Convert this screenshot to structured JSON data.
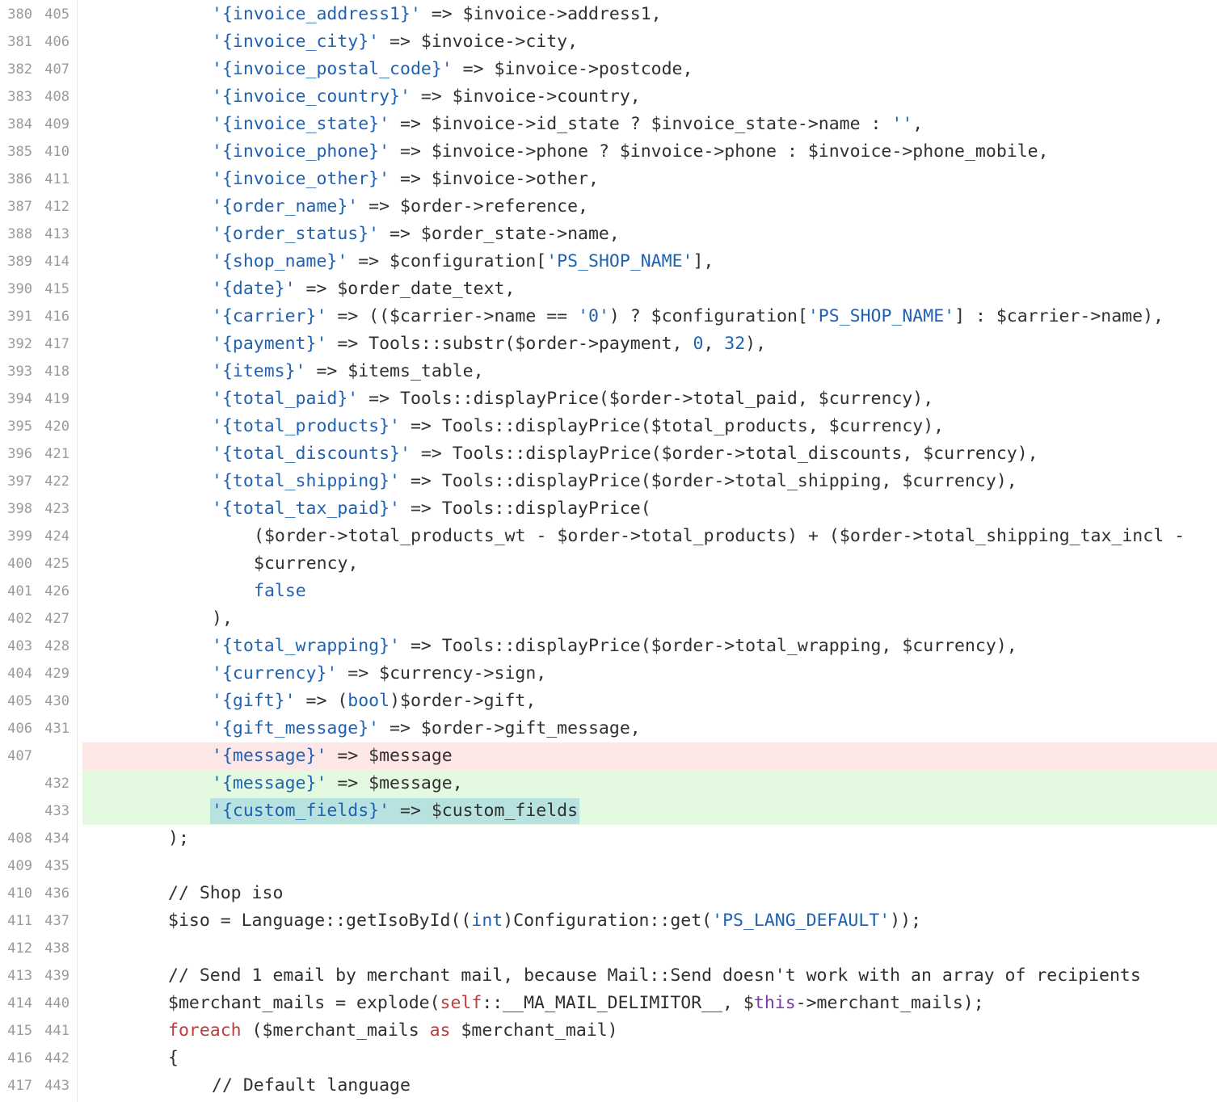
{
  "diff": {
    "lines": [
      {
        "old": "380",
        "new": "405",
        "type": "context",
        "indent": 3,
        "tokens": [
          {
            "t": "'{invoice_address1}'",
            "c": "str"
          },
          {
            "t": " => $invoice->address1,",
            "c": ""
          }
        ]
      },
      {
        "old": "381",
        "new": "406",
        "type": "context",
        "indent": 3,
        "tokens": [
          {
            "t": "'{invoice_city}'",
            "c": "str"
          },
          {
            "t": " => $invoice->city,",
            "c": ""
          }
        ]
      },
      {
        "old": "382",
        "new": "407",
        "type": "context",
        "indent": 3,
        "tokens": [
          {
            "t": "'{invoice_postal_code}'",
            "c": "str"
          },
          {
            "t": " => $invoice->postcode,",
            "c": ""
          }
        ]
      },
      {
        "old": "383",
        "new": "408",
        "type": "context",
        "indent": 3,
        "tokens": [
          {
            "t": "'{invoice_country}'",
            "c": "str"
          },
          {
            "t": " => $invoice->country,",
            "c": ""
          }
        ]
      },
      {
        "old": "384",
        "new": "409",
        "type": "context",
        "indent": 3,
        "tokens": [
          {
            "t": "'{invoice_state}'",
            "c": "str"
          },
          {
            "t": " => $invoice->id_state ? $invoice_state->name : ",
            "c": ""
          },
          {
            "t": "''",
            "c": "str"
          },
          {
            "t": ",",
            "c": ""
          }
        ]
      },
      {
        "old": "385",
        "new": "410",
        "type": "context",
        "indent": 3,
        "tokens": [
          {
            "t": "'{invoice_phone}'",
            "c": "str"
          },
          {
            "t": " => $invoice->phone ? $invoice->phone : $invoice->phone_mobile,",
            "c": ""
          }
        ]
      },
      {
        "old": "386",
        "new": "411",
        "type": "context",
        "indent": 3,
        "tokens": [
          {
            "t": "'{invoice_other}'",
            "c": "str"
          },
          {
            "t": " => $invoice->other,",
            "c": ""
          }
        ]
      },
      {
        "old": "387",
        "new": "412",
        "type": "context",
        "indent": 3,
        "tokens": [
          {
            "t": "'{order_name}'",
            "c": "str"
          },
          {
            "t": " => $order->reference,",
            "c": ""
          }
        ]
      },
      {
        "old": "388",
        "new": "413",
        "type": "context",
        "indent": 3,
        "tokens": [
          {
            "t": "'{order_status}'",
            "c": "str"
          },
          {
            "t": " => $order_state->name,",
            "c": ""
          }
        ]
      },
      {
        "old": "389",
        "new": "414",
        "type": "context",
        "indent": 3,
        "tokens": [
          {
            "t": "'{shop_name}'",
            "c": "str"
          },
          {
            "t": " => $configuration[",
            "c": ""
          },
          {
            "t": "'PS_SHOP_NAME'",
            "c": "str"
          },
          {
            "t": "],",
            "c": ""
          }
        ]
      },
      {
        "old": "390",
        "new": "415",
        "type": "context",
        "indent": 3,
        "tokens": [
          {
            "t": "'{date}'",
            "c": "str"
          },
          {
            "t": " => $order_date_text,",
            "c": ""
          }
        ]
      },
      {
        "old": "391",
        "new": "416",
        "type": "context",
        "indent": 3,
        "tokens": [
          {
            "t": "'{carrier}'",
            "c": "str"
          },
          {
            "t": " => (($carrier->name == ",
            "c": ""
          },
          {
            "t": "'0'",
            "c": "str"
          },
          {
            "t": ") ? $configuration[",
            "c": ""
          },
          {
            "t": "'PS_SHOP_NAME'",
            "c": "str"
          },
          {
            "t": "] : $carrier->name),",
            "c": ""
          }
        ]
      },
      {
        "old": "392",
        "new": "417",
        "type": "context",
        "indent": 3,
        "tokens": [
          {
            "t": "'{payment}'",
            "c": "str"
          },
          {
            "t": " => Tools::substr($order->payment, ",
            "c": ""
          },
          {
            "t": "0",
            "c": "kw"
          },
          {
            "t": ", ",
            "c": ""
          },
          {
            "t": "32",
            "c": "kw"
          },
          {
            "t": "),",
            "c": ""
          }
        ]
      },
      {
        "old": "393",
        "new": "418",
        "type": "context",
        "indent": 3,
        "tokens": [
          {
            "t": "'{items}'",
            "c": "str"
          },
          {
            "t": " => $items_table,",
            "c": ""
          }
        ]
      },
      {
        "old": "394",
        "new": "419",
        "type": "context",
        "indent": 3,
        "tokens": [
          {
            "t": "'{total_paid}'",
            "c": "str"
          },
          {
            "t": " => Tools::displayPrice($order->total_paid, $currency),",
            "c": ""
          }
        ]
      },
      {
        "old": "395",
        "new": "420",
        "type": "context",
        "indent": 3,
        "tokens": [
          {
            "t": "'{total_products}'",
            "c": "str"
          },
          {
            "t": " => Tools::displayPrice($total_products, $currency),",
            "c": ""
          }
        ]
      },
      {
        "old": "396",
        "new": "421",
        "type": "context",
        "indent": 3,
        "tokens": [
          {
            "t": "'{total_discounts}'",
            "c": "str"
          },
          {
            "t": " => Tools::displayPrice($order->total_discounts, $currency),",
            "c": ""
          }
        ]
      },
      {
        "old": "397",
        "new": "422",
        "type": "context",
        "indent": 3,
        "tokens": [
          {
            "t": "'{total_shipping}'",
            "c": "str"
          },
          {
            "t": " => Tools::displayPrice($order->total_shipping, $currency),",
            "c": ""
          }
        ]
      },
      {
        "old": "398",
        "new": "423",
        "type": "context",
        "indent": 3,
        "tokens": [
          {
            "t": "'{total_tax_paid}'",
            "c": "str"
          },
          {
            "t": " => Tools::displayPrice(",
            "c": ""
          }
        ]
      },
      {
        "old": "399",
        "new": "424",
        "type": "context",
        "indent": 4,
        "tokens": [
          {
            "t": "($order->total_products_wt - $order->total_products) + ($order->total_shipping_tax_incl -",
            "c": ""
          }
        ]
      },
      {
        "old": "400",
        "new": "425",
        "type": "context",
        "indent": 4,
        "tokens": [
          {
            "t": "$currency,",
            "c": ""
          }
        ]
      },
      {
        "old": "401",
        "new": "426",
        "type": "context",
        "indent": 4,
        "tokens": [
          {
            "t": "false",
            "c": "kw"
          }
        ]
      },
      {
        "old": "402",
        "new": "427",
        "type": "context",
        "indent": 3,
        "tokens": [
          {
            "t": "),",
            "c": ""
          }
        ]
      },
      {
        "old": "403",
        "new": "428",
        "type": "context",
        "indent": 3,
        "tokens": [
          {
            "t": "'{total_wrapping}'",
            "c": "str"
          },
          {
            "t": " => Tools::displayPrice($order->total_wrapping, $currency),",
            "c": ""
          }
        ]
      },
      {
        "old": "404",
        "new": "429",
        "type": "context",
        "indent": 3,
        "tokens": [
          {
            "t": "'{currency}'",
            "c": "str"
          },
          {
            "t": " => $currency->sign,",
            "c": ""
          }
        ]
      },
      {
        "old": "405",
        "new": "430",
        "type": "context",
        "indent": 3,
        "tokens": [
          {
            "t": "'{gift}'",
            "c": "str"
          },
          {
            "t": " => (",
            "c": ""
          },
          {
            "t": "bool",
            "c": "kw"
          },
          {
            "t": ")$order->gift,",
            "c": ""
          }
        ]
      },
      {
        "old": "406",
        "new": "431",
        "type": "context",
        "indent": 3,
        "tokens": [
          {
            "t": "'{gift_message}'",
            "c": "str"
          },
          {
            "t": " => $order->gift_message,",
            "c": ""
          }
        ]
      },
      {
        "old": "407",
        "new": "",
        "type": "removed",
        "indent": 3,
        "tokens": [
          {
            "t": "'{message}'",
            "c": "str"
          },
          {
            "t": " => $message",
            "c": ""
          }
        ]
      },
      {
        "old": "",
        "new": "432",
        "type": "added",
        "indent": 3,
        "tokens": [
          {
            "t": "'{message}'",
            "c": "str"
          },
          {
            "t": " => $message,",
            "c": ""
          }
        ]
      },
      {
        "old": "",
        "new": "433",
        "type": "added",
        "indent": 3,
        "highlight": true,
        "tokens": [
          {
            "t": "'{custom_fields}'",
            "c": "str"
          },
          {
            "t": " => $custom_fields",
            "c": ""
          }
        ]
      },
      {
        "old": "408",
        "new": "434",
        "type": "context",
        "indent": 2,
        "tokens": [
          {
            "t": ");",
            "c": ""
          }
        ]
      },
      {
        "old": "409",
        "new": "435",
        "type": "context",
        "indent": 2,
        "tokens": []
      },
      {
        "old": "410",
        "new": "436",
        "type": "context",
        "indent": 2,
        "tokens": [
          {
            "t": "// Shop iso",
            "c": "cmt"
          }
        ]
      },
      {
        "old": "411",
        "new": "437",
        "type": "context",
        "indent": 2,
        "tokens": [
          {
            "t": "$iso = Language::getIsoById((",
            "c": ""
          },
          {
            "t": "int",
            "c": "kw"
          },
          {
            "t": ")Configuration::get(",
            "c": ""
          },
          {
            "t": "'PS_LANG_DEFAULT'",
            "c": "str"
          },
          {
            "t": "));",
            "c": ""
          }
        ]
      },
      {
        "old": "412",
        "new": "438",
        "type": "context",
        "indent": 2,
        "tokens": []
      },
      {
        "old": "413",
        "new": "439",
        "type": "context",
        "indent": 2,
        "tokens": [
          {
            "t": "// Send 1 email by merchant mail, because Mail::Send doesn't work with an array of recipients",
            "c": "cmt"
          }
        ]
      },
      {
        "old": "414",
        "new": "440",
        "type": "context",
        "indent": 2,
        "tokens": [
          {
            "t": "$merchant_mails = explode(",
            "c": ""
          },
          {
            "t": "self",
            "c": "self"
          },
          {
            "t": "::__MA_MAIL_DELIMITOR__, $",
            "c": ""
          },
          {
            "t": "this",
            "c": "this"
          },
          {
            "t": "->merchant_mails);",
            "c": ""
          }
        ]
      },
      {
        "old": "415",
        "new": "441",
        "type": "context",
        "indent": 2,
        "tokens": [
          {
            "t": "foreach",
            "c": "ctrl"
          },
          {
            "t": " ($merchant_mails ",
            "c": ""
          },
          {
            "t": "as",
            "c": "ctrl"
          },
          {
            "t": " $merchant_mail)",
            "c": ""
          }
        ]
      },
      {
        "old": "416",
        "new": "442",
        "type": "context",
        "indent": 2,
        "tokens": [
          {
            "t": "{",
            "c": ""
          }
        ]
      },
      {
        "old": "417",
        "new": "443",
        "type": "context",
        "indent": 3,
        "tokens": [
          {
            "t": "// Default language",
            "c": "cmt"
          }
        ]
      }
    ]
  }
}
